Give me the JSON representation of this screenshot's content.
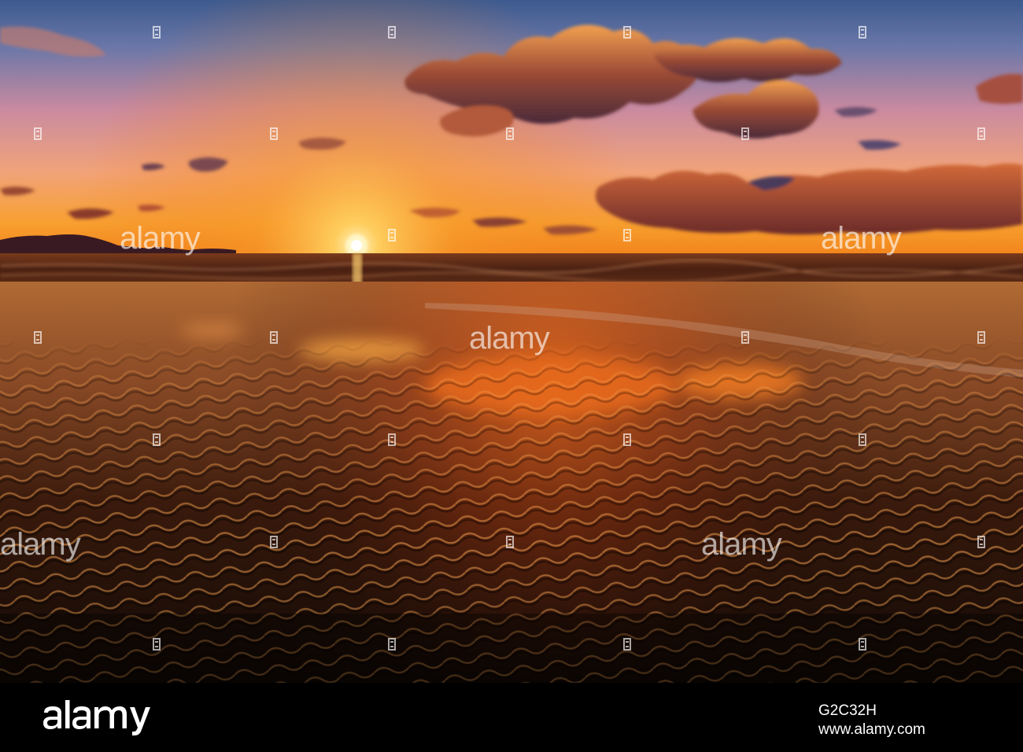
{
  "watermark": {
    "brand_text": "alamy",
    "image_id": "G2C32H",
    "site_url": "www.alamy.com"
  },
  "scene": {
    "subject": "sunset over a beach with rippled wet sand reflecting orange clouds",
    "colors": {
      "sky_top": "#3d5a8e",
      "sky_mid": "#c98aa0",
      "sky_glow": "#f9a030",
      "sun": "#fff6c8",
      "sand_dark": "#120a06",
      "reflection": "#e8681c"
    }
  }
}
